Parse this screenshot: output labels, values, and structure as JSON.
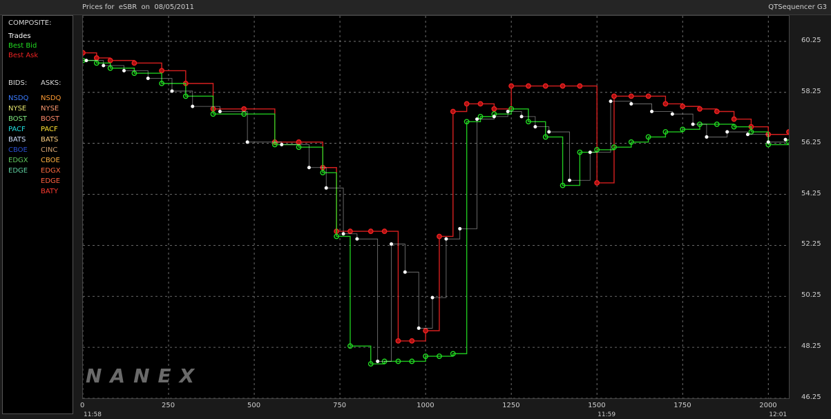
{
  "window": {
    "title": "Prices for  eSBR  on  08/05/2011",
    "app_name": "QTSequencer G3"
  },
  "watermark": "NANEX",
  "legend": {
    "composite_header": "COMPOSITE:",
    "composite": [
      {
        "label": "Trades",
        "color": "#ffffff"
      },
      {
        "label": "Best Bid",
        "color": "#22dd22"
      },
      {
        "label": "Best Ask",
        "color": "#ee2222"
      }
    ],
    "bids_header": "BIDS:",
    "asks_header": "ASKS:",
    "bids": [
      {
        "label": "NSDQ",
        "color": "#3a7bff"
      },
      {
        "label": "NYSE",
        "color": "#e8e870"
      },
      {
        "label": "BOST",
        "color": "#7fe87f"
      },
      {
        "label": "PACF",
        "color": "#22e0e0"
      },
      {
        "label": "BATS",
        "color": "#cfe0ff"
      },
      {
        "label": "CBOE",
        "color": "#2a4fd0"
      },
      {
        "label": "EDGX",
        "color": "#5fc85f"
      },
      {
        "label": "EDGE",
        "color": "#5fd0a0"
      }
    ],
    "asks": [
      {
        "label": "NSDQ",
        "color": "#ff9a30"
      },
      {
        "label": "NYSE",
        "color": "#ff9a70"
      },
      {
        "label": "BOST",
        "color": "#ff8a6a"
      },
      {
        "label": "PACF",
        "color": "#ffe030"
      },
      {
        "label": "BATS",
        "color": "#ffd080"
      },
      {
        "label": "CINC",
        "color": "#d0a070"
      },
      {
        "label": "CBOE",
        "color": "#ffb040"
      },
      {
        "label": "EDGX",
        "color": "#ff6a40"
      },
      {
        "label": "EDGE",
        "color": "#ff6040"
      },
      {
        "label": "BATY",
        "color": "#ff3a30"
      }
    ]
  },
  "chart_data": {
    "type": "line",
    "title": "Prices for  eSBR  on  08/05/2011",
    "xlabel": "",
    "ylabel": "",
    "xlim": [
      0,
      2060
    ],
    "ylim": [
      46.25,
      61.25
    ],
    "x_ticks": [
      0,
      250,
      500,
      750,
      1000,
      1250,
      1500,
      1750,
      2000
    ],
    "x_tick_labels": [
      "0",
      "250",
      "500",
      "750",
      "1000",
      "1250",
      "1500",
      "1750",
      "2000"
    ],
    "y_ticks": [
      46.25,
      48.25,
      50.25,
      52.25,
      54.25,
      56.25,
      58.25,
      60.25
    ],
    "y_tick_labels": [
      "46.25",
      "48.25",
      "50.25",
      "52.25",
      "54.25",
      "56.25",
      "58.25",
      "60.25"
    ],
    "time_labels": [
      {
        "x": 0,
        "label": "11:58"
      },
      {
        "x": 1500,
        "label": "11:59"
      },
      {
        "x": 2000,
        "label": "12:01"
      }
    ],
    "grid": true,
    "series": [
      {
        "name": "Best Ask",
        "color": "#ee2222",
        "marker": "red-circle",
        "x": [
          0,
          40,
          80,
          150,
          230,
          300,
          380,
          470,
          560,
          630,
          700,
          740,
          780,
          840,
          880,
          920,
          960,
          1000,
          1040,
          1080,
          1120,
          1160,
          1200,
          1250,
          1300,
          1350,
          1400,
          1450,
          1500,
          1550,
          1600,
          1650,
          1700,
          1750,
          1800,
          1850,
          1900,
          1950,
          2000,
          2060
        ],
        "y": [
          59.8,
          59.6,
          59.5,
          59.4,
          59.1,
          58.6,
          57.6,
          57.6,
          56.3,
          56.3,
          55.3,
          52.8,
          52.8,
          52.8,
          52.8,
          48.5,
          48.5,
          48.9,
          52.6,
          57.5,
          57.8,
          57.8,
          57.6,
          58.5,
          58.5,
          58.5,
          58.5,
          58.5,
          54.7,
          58.1,
          58.1,
          58.1,
          57.8,
          57.7,
          57.6,
          57.5,
          57.2,
          56.9,
          56.6,
          56.7
        ]
      },
      {
        "name": "Best Bid",
        "color": "#22dd22",
        "marker": "green-circle",
        "x": [
          0,
          40,
          80,
          150,
          230,
          300,
          380,
          470,
          560,
          630,
          700,
          740,
          780,
          840,
          880,
          920,
          960,
          1000,
          1040,
          1080,
          1120,
          1160,
          1200,
          1250,
          1300,
          1350,
          1400,
          1450,
          1500,
          1550,
          1600,
          1650,
          1700,
          1750,
          1800,
          1850,
          1900,
          1950,
          2000,
          2060
        ],
        "y": [
          59.5,
          59.4,
          59.2,
          59.0,
          58.6,
          58.1,
          57.4,
          57.4,
          56.2,
          56.1,
          55.1,
          52.6,
          48.3,
          47.6,
          47.7,
          47.7,
          47.7,
          47.9,
          47.9,
          48.0,
          57.1,
          57.3,
          57.4,
          57.6,
          57.1,
          56.5,
          54.6,
          55.9,
          56.0,
          56.1,
          56.3,
          56.5,
          56.7,
          56.8,
          57.0,
          57.0,
          56.9,
          56.7,
          56.2,
          56.3
        ]
      },
      {
        "name": "Trades",
        "color": "#ffffff",
        "marker": "white-dot",
        "x": [
          10,
          60,
          120,
          190,
          260,
          320,
          400,
          480,
          580,
          660,
          710,
          760,
          800,
          860,
          900,
          940,
          980,
          1020,
          1060,
          1100,
          1150,
          1200,
          1240,
          1280,
          1320,
          1360,
          1420,
          1480,
          1540,
          1600,
          1660,
          1720,
          1780,
          1820,
          1880,
          1940,
          2000,
          2050
        ],
        "y": [
          59.5,
          59.3,
          59.1,
          58.8,
          58.3,
          57.7,
          57.5,
          56.3,
          56.2,
          55.3,
          54.5,
          52.7,
          52.5,
          47.7,
          52.3,
          51.2,
          49.0,
          50.2,
          52.5,
          52.9,
          57.2,
          57.3,
          57.5,
          57.3,
          56.9,
          56.7,
          54.8,
          55.9,
          57.9,
          57.8,
          57.5,
          57.4,
          57.0,
          56.5,
          56.7,
          56.6,
          56.3,
          56.4
        ]
      }
    ]
  }
}
